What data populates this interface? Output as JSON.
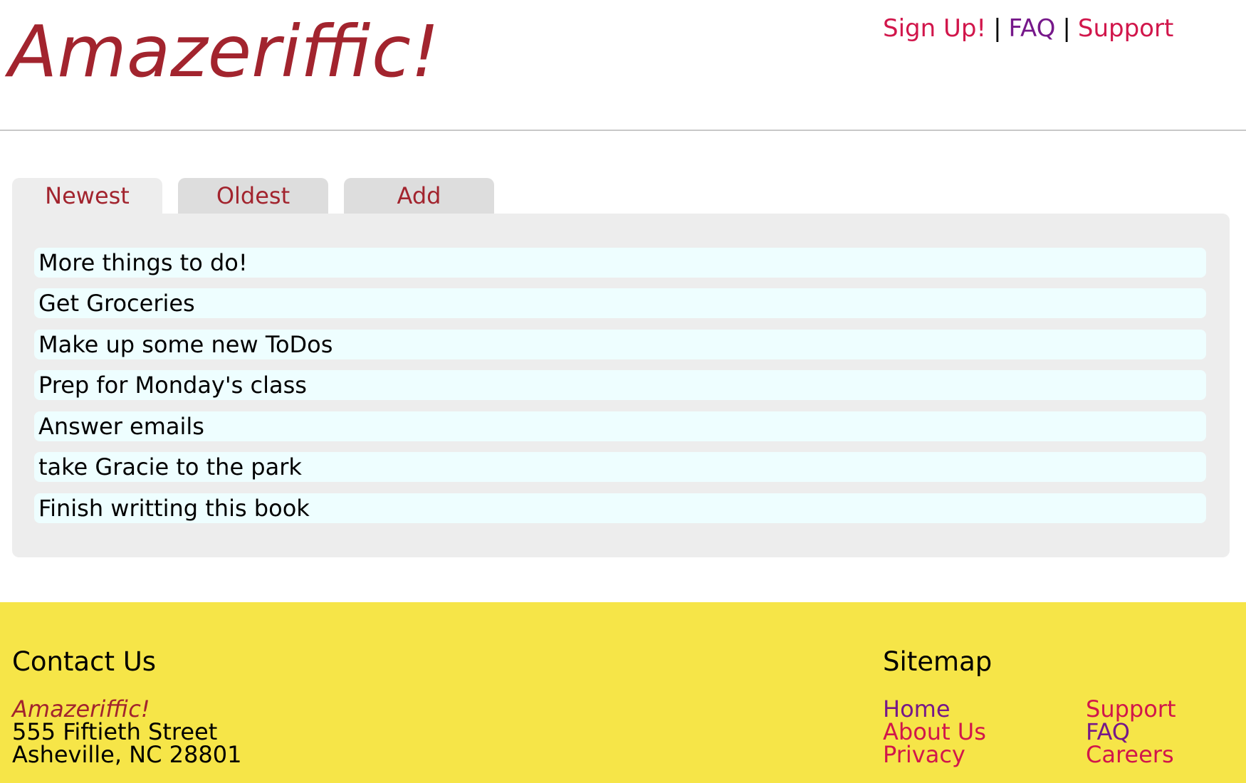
{
  "header": {
    "logo": "Amazeriffic!",
    "nav": {
      "signup": "Sign Up!",
      "faq": "FAQ",
      "support": "Support",
      "separator": "|"
    }
  },
  "tabs": [
    {
      "label": "Newest",
      "active": true
    },
    {
      "label": "Oldest",
      "active": false
    },
    {
      "label": "Add",
      "active": false
    }
  ],
  "todos": [
    "More things to do!",
    "Get Groceries",
    "Make up some new ToDos",
    "Prep for Monday's class",
    "Answer emails",
    "take Gracie to the park",
    "Finish writting this book"
  ],
  "footer": {
    "contact": {
      "title": "Contact Us",
      "name": "Amazeriffic!",
      "street": "555 Fiftieth Street",
      "city": "Asheville, NC 28801"
    },
    "sitemap": {
      "title": "Sitemap",
      "home": "Home",
      "about": "About Us",
      "privacy": "Privacy",
      "support": "Support",
      "faq": "FAQ",
      "careers": "Careers"
    }
  },
  "colors": {
    "brand": "#a2242e",
    "link": "#d1164b",
    "visited_link": "#76188a",
    "footer_bg": "#f6e548",
    "panel_bg": "#ededed",
    "todo_bg": "#eefeff"
  }
}
